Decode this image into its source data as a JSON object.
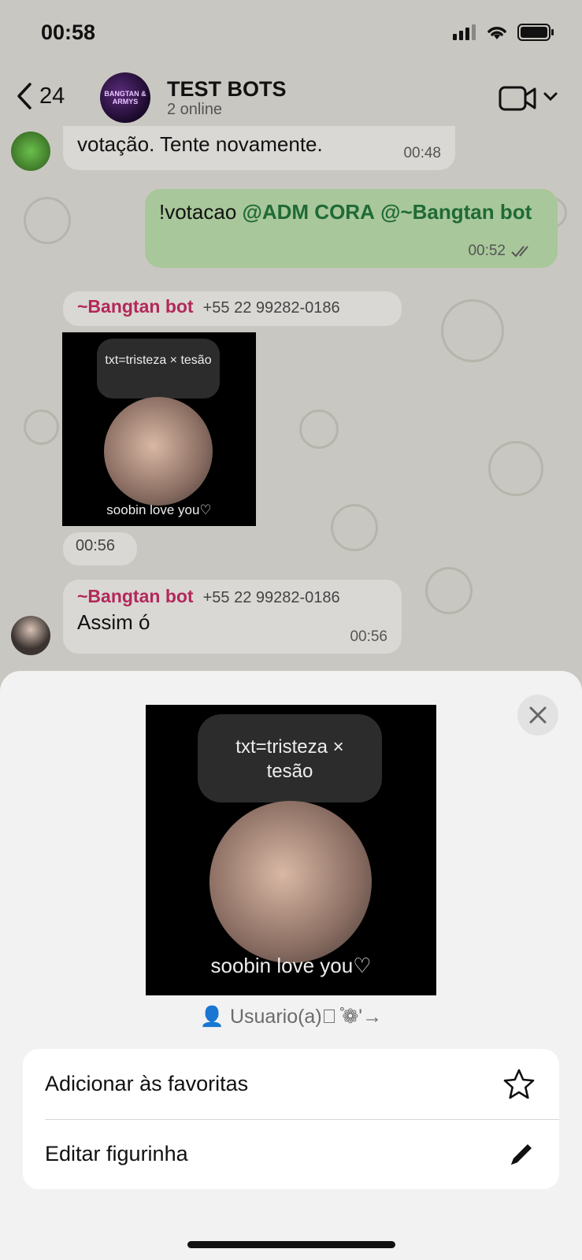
{
  "status_bar": {
    "time": "00:58"
  },
  "header": {
    "back_count": "24",
    "group_name": "TEST BOTS",
    "group_status": "2 online",
    "group_avatar_text": "BANGTAN & ARMYS"
  },
  "messages": {
    "m1": {
      "text": "votação. Tente novamente.",
      "time": "00:48"
    },
    "m2": {
      "text": "!votacao ",
      "mention1": "@ADM CORA",
      "mention2": "@~Bangtan bot",
      "time": "00:52"
    },
    "m3": {
      "sender": "~Bangtan bot",
      "phone": "+55 22 99282-0186",
      "time": "00:56"
    },
    "m4": {
      "sender": "~Bangtan bot",
      "phone": "+55 22 99282-0186",
      "text": "Assim ó",
      "time": "00:56"
    }
  },
  "sticker": {
    "top_text": "txt=tristeza × tesão",
    "caption": "soobin love you♡"
  },
  "sheet": {
    "owner": "👤 Usuario(a)᳟ ̊❁'→",
    "menu": [
      {
        "label": "Adicionar às favoritas",
        "icon": "star-icon"
      },
      {
        "label": "Editar figurinha",
        "icon": "pencil-icon"
      }
    ]
  },
  "colors": {
    "sender": "#b3285a",
    "mention": "#1f6a36",
    "outgoing_bubble": "#a8c79a"
  }
}
